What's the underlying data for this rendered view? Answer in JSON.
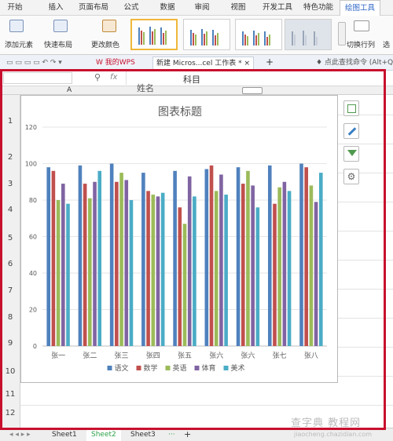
{
  "ribbon": {
    "tabs": [
      "开始",
      "插入",
      "页面布局",
      "公式",
      "数据",
      "审阅",
      "视图",
      "开发工具",
      "特色功能",
      "绘图工具"
    ],
    "active_tab": 9,
    "buttons": {
      "add_element": "添加元素",
      "quick_layout": "快速布局",
      "change_color": "更改颜色",
      "switch_row_col": "切换行列",
      "extra": "选"
    }
  },
  "doc_tabs": {
    "my_wps": "我的WPS",
    "workbook": "新建 Micros...cel 工作表 *",
    "search": "点此查找命令 (Alt+Q)"
  },
  "formula_bar": {
    "fx": "fx",
    "content": "科目",
    "name_box": ""
  },
  "sheet": {
    "col_a": "A",
    "cell_b1": "姓名",
    "rows": [
      "1",
      "2",
      "3",
      "4",
      "5",
      "6",
      "7",
      "8",
      "9",
      "10",
      "11",
      "12"
    ]
  },
  "chart_data": {
    "type": "bar",
    "title": "图表标题",
    "categories": [
      "张一",
      "张二",
      "张三",
      "张四",
      "张五",
      "张六",
      "张六",
      "张七",
      "张八"
    ],
    "series": [
      {
        "name": "语文",
        "color": "#4f81bd",
        "values": [
          98,
          99,
          100,
          95,
          96,
          97,
          98,
          99,
          100
        ]
      },
      {
        "name": "数学",
        "color": "#c0504d",
        "values": [
          96,
          89,
          90,
          85,
          76,
          99,
          89,
          78,
          98
        ]
      },
      {
        "name": "英语",
        "color": "#9bbb59",
        "values": [
          80,
          81,
          95,
          83,
          67,
          85,
          96,
          87,
          88
        ]
      },
      {
        "name": "体育",
        "color": "#8064a2",
        "values": [
          89,
          90,
          91,
          82,
          93,
          94,
          88,
          90,
          79
        ]
      },
      {
        "name": "美术",
        "color": "#4bacc6",
        "values": [
          78,
          96,
          80,
          84,
          82,
          83,
          76,
          85,
          95
        ]
      }
    ],
    "ylim": [
      0,
      120
    ],
    "yticks": [
      0,
      20,
      40,
      60,
      80,
      100,
      120
    ],
    "grid": true,
    "legend": "bottom"
  },
  "sheet_tabs": {
    "tabs": [
      "Sheet1",
      "Sheet2",
      "Sheet3"
    ],
    "active": 1,
    "more": "···",
    "add": "+"
  },
  "watermark": {
    "main": "查字典 教程网",
    "sub": "jiaocheng.chazidian.com"
  },
  "colors": {
    "highlight_frame": "#c8102e",
    "active_sheet": "#2ea24a"
  }
}
